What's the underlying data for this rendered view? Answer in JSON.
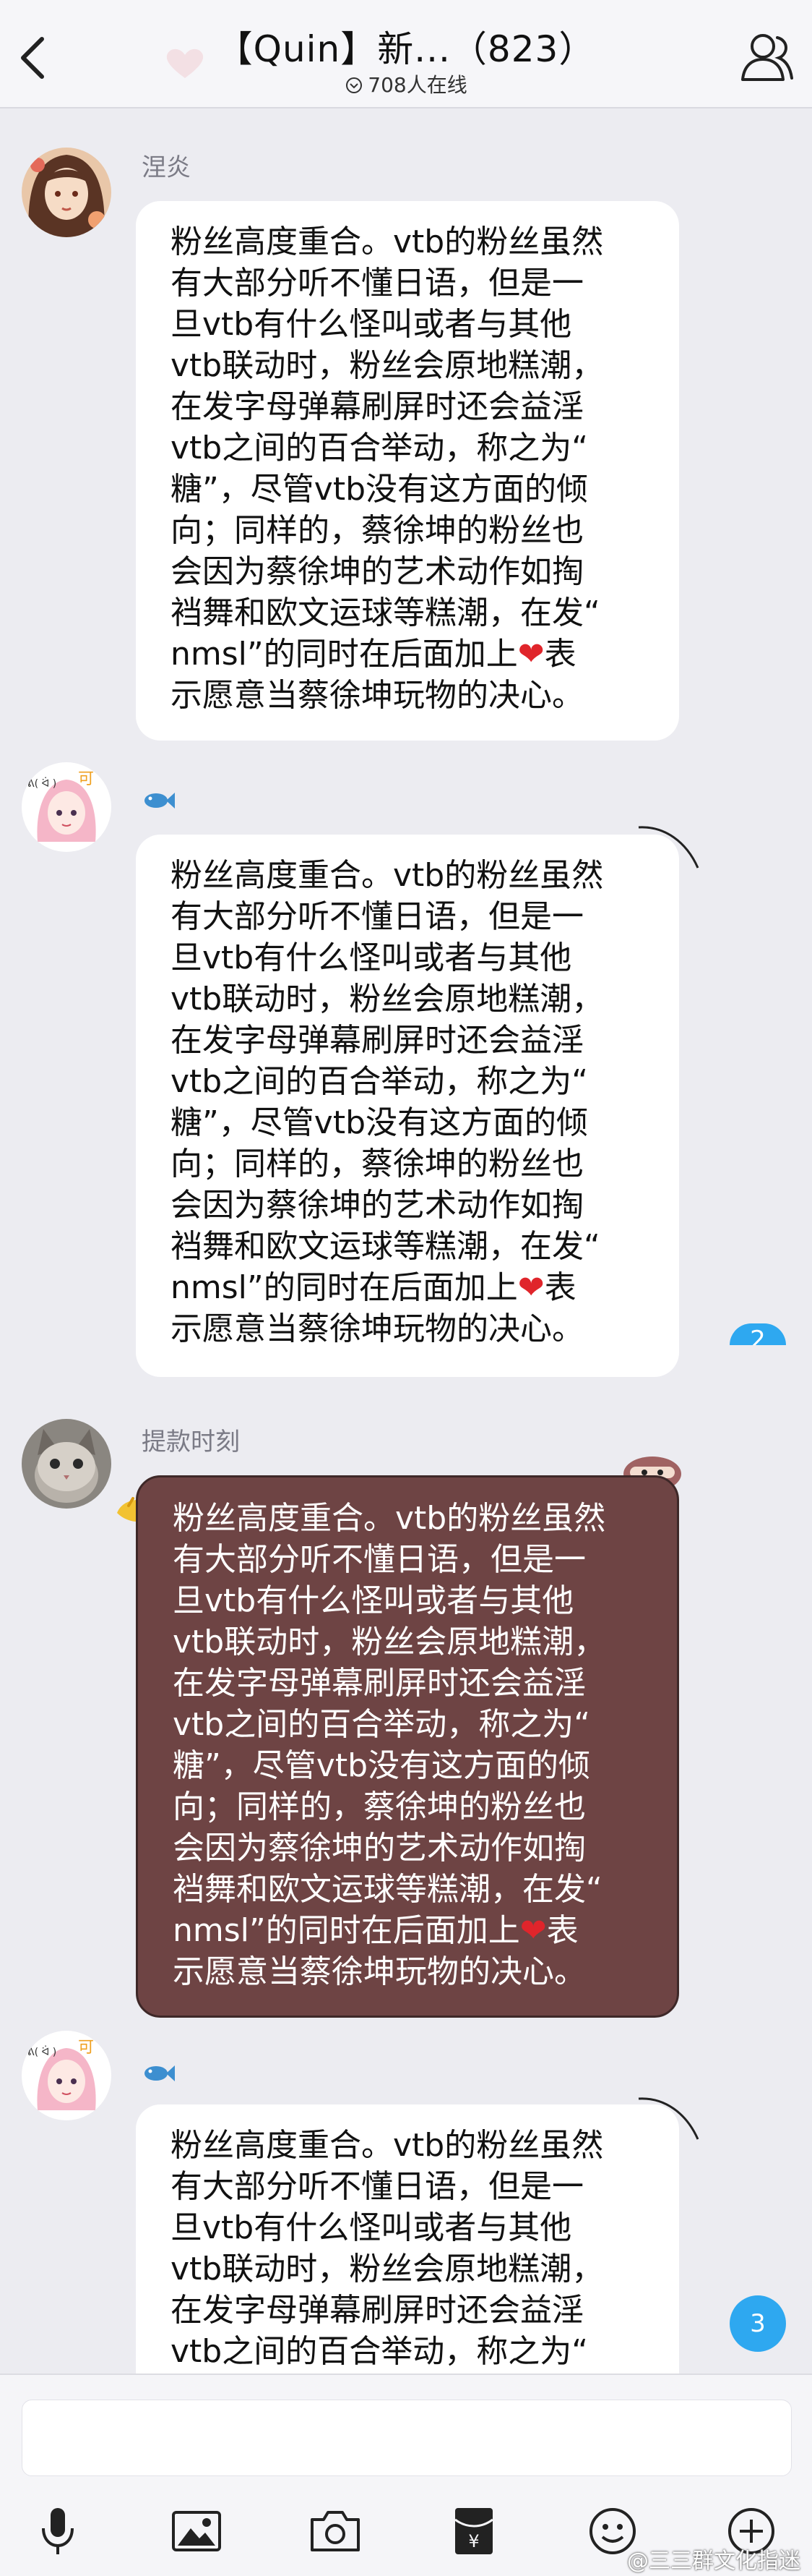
{
  "header": {
    "title": "【Quin】新...（823）",
    "online": "708人在线"
  },
  "message_text": [
    "粉丝高度重合。vtb的粉丝虽然",
    "有大部分听不懂日语，但是一",
    "旦vtb有什么怪叫或者与其他",
    "vtb联动时，粉丝会原地糕潮，",
    "在发字母弹幕刷屏时还会益淫",
    "vtb之间的百合举动，称之为“",
    "糖”，尽管vtb没有这方面的倾",
    "向；同样的，蔡徐坤的粉丝也",
    "会因为蔡徐坤的艺术动作如掏",
    "裆舞和欧文运球等糕潮，在发“",
    "nmsl”的同时在后面加上",
    "表",
    "示愿意当蔡徐坤玩物的决心。"
  ],
  "heart_glyph": "❤",
  "messages": [
    {
      "sender": "涅炎",
      "avatar": "anime-girl-avatar"
    },
    {
      "sender": "",
      "avatar": "pink-hair-chibi-avatar",
      "badge": "fish-icon"
    },
    {
      "sender": "提款时刻",
      "avatar": "cat-photo-avatar",
      "style": "dark"
    },
    {
      "sender": "",
      "avatar": "pink-hair-chibi-avatar",
      "badge": "fish-icon"
    }
  ],
  "unread_badges": [
    "2",
    "3"
  ],
  "watermark": "@三三群文化指迷",
  "colors": {
    "background": "#ececf1",
    "bubble": "#ffffff",
    "bubble_dark": "#6e4444",
    "badge": "#2ea8f0",
    "heart": "#e0252b"
  }
}
